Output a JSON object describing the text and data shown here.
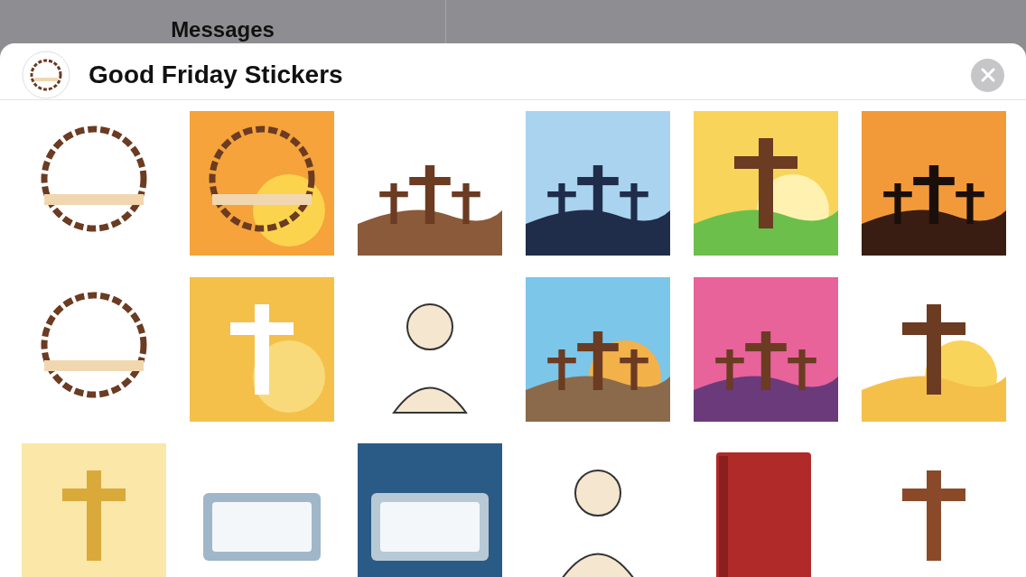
{
  "behind": {
    "title": "Messages"
  },
  "sheet": {
    "title": "Good Friday Stickers"
  }
}
